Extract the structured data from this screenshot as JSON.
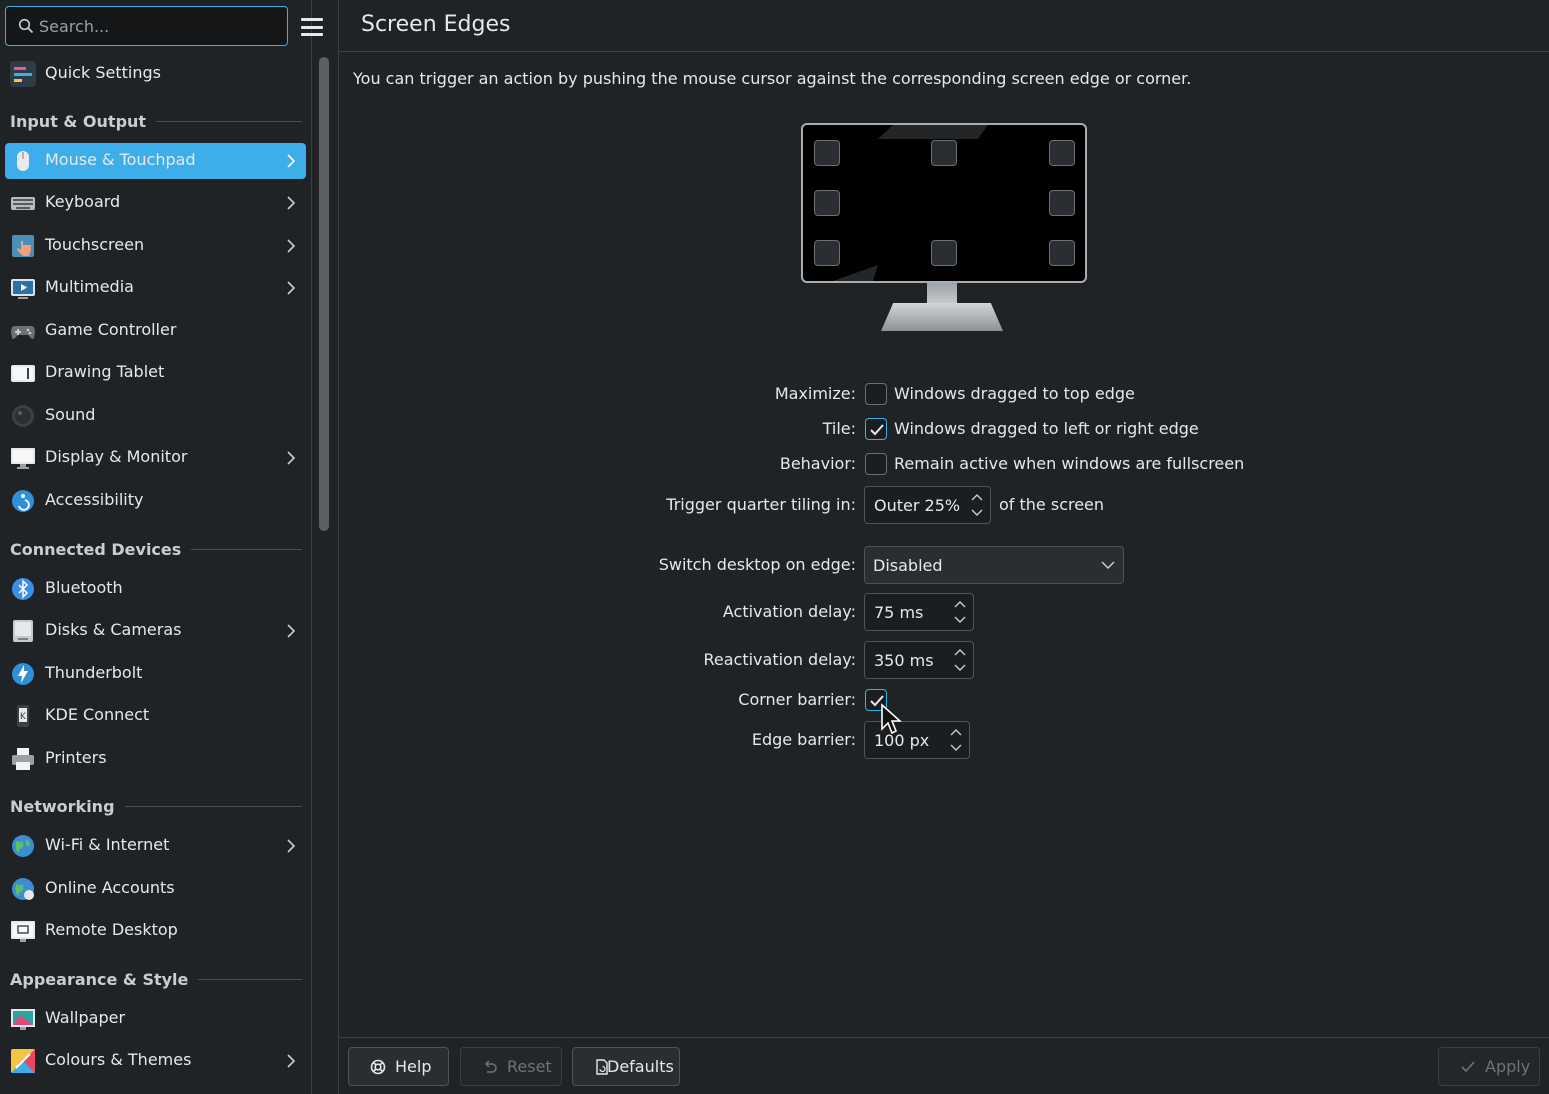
{
  "search": {
    "placeholder": "Search..."
  },
  "header": {
    "title": "Screen Edges"
  },
  "sidebar": {
    "items": [
      {
        "label": "Quick Settings"
      },
      {
        "label": "Input & Output"
      },
      {
        "label": "Mouse & Touchpad"
      },
      {
        "label": "Keyboard"
      },
      {
        "label": "Touchscreen"
      },
      {
        "label": "Multimedia"
      },
      {
        "label": "Game Controller"
      },
      {
        "label": "Drawing Tablet"
      },
      {
        "label": "Sound"
      },
      {
        "label": "Display & Monitor"
      },
      {
        "label": "Accessibility"
      },
      {
        "label": "Connected Devices"
      },
      {
        "label": "Bluetooth"
      },
      {
        "label": "Disks & Cameras"
      },
      {
        "label": "Thunderbolt"
      },
      {
        "label": "KDE Connect"
      },
      {
        "label": "Printers"
      },
      {
        "label": "Networking"
      },
      {
        "label": "Wi-Fi & Internet"
      },
      {
        "label": "Online Accounts"
      },
      {
        "label": "Remote Desktop"
      },
      {
        "label": "Appearance & Style"
      },
      {
        "label": "Wallpaper"
      },
      {
        "label": "Colours & Themes"
      }
    ]
  },
  "main": {
    "intro": "You can trigger an action by pushing the mouse cursor against the corresponding screen edge or corner.",
    "maximize": {
      "label": "Maximize:",
      "text": "Windows dragged to top edge",
      "checked": false
    },
    "tile": {
      "label": "Tile:",
      "text": "Windows dragged to left or right edge",
      "checked": true
    },
    "behavior": {
      "label": "Behavior:",
      "text": "Remain active when windows are fullscreen",
      "checked": false
    },
    "quarter": {
      "label": "Trigger quarter tiling in:",
      "value": "Outer 25%",
      "suffix": "of the screen"
    },
    "switch_desktop": {
      "label": "Switch desktop on edge:",
      "value": "Disabled"
    },
    "activation": {
      "label": "Activation delay:",
      "value": "75 ms"
    },
    "reactivation": {
      "label": "Reactivation delay:",
      "value": "350 ms"
    },
    "corner_barrier": {
      "label": "Corner barrier:",
      "checked": true
    },
    "edge_barrier": {
      "label": "Edge barrier:",
      "value": "100 px"
    }
  },
  "footer": {
    "help": "Help",
    "reset": "Reset",
    "defaults": "Defaults",
    "apply": "Apply"
  },
  "colors": {
    "accent": "#3daee9",
    "background": "#202326"
  }
}
